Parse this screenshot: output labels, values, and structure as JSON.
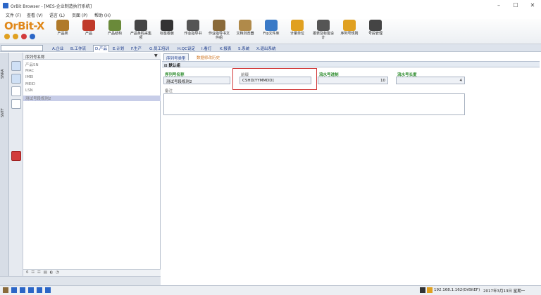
{
  "window": {
    "title": "OrBit Browser - [MES-企业制造执行系统]",
    "minimize": "–",
    "maximize": "☐",
    "close": "✕"
  },
  "menu": [
    "文件 (F)",
    "查看 (V)",
    "语言 (L)",
    "页面 (P)",
    "帮助 (H)"
  ],
  "logo": "OrBit-X",
  "toolbar": [
    {
      "label": "产品类",
      "icon": "product-class-icon",
      "color": "#b07a2a"
    },
    {
      "label": "产品",
      "icon": "product-icon",
      "color": "#c03a2a"
    },
    {
      "label": "产品结构",
      "icon": "product-structure-icon",
      "color": "#6a8a3a"
    },
    {
      "label": "产品条码采集项",
      "icon": "barcode-collect-icon",
      "color": "#444444"
    },
    {
      "label": "标签模板",
      "icon": "label-template-icon",
      "color": "#333333"
    },
    {
      "label": "作业指导书",
      "icon": "work-instruction-icon",
      "color": "#555555"
    },
    {
      "label": "作业指导书文件组",
      "icon": "instruction-group-icon",
      "color": "#8a6a3a"
    },
    {
      "label": "文档浏览器",
      "icon": "doc-browser-icon",
      "color": "#b08a4a"
    },
    {
      "label": "Ftp文件库",
      "icon": "ftp-library-icon",
      "color": "#3a7ac7"
    },
    {
      "label": "计量单位",
      "icon": "unit-icon",
      "color": "#e0a020"
    },
    {
      "label": "报表及标签设计",
      "icon": "report-design-icon",
      "color": "#555555"
    },
    {
      "label": "序列号规则",
      "icon": "serial-rule-icon",
      "color": "#e0a020"
    },
    {
      "label": "号段管理",
      "icon": "segment-manage-icon",
      "color": "#444444"
    }
  ],
  "modules": [
    {
      "label": "A.企业",
      "active": false
    },
    {
      "label": "B.工作流",
      "active": false
    },
    {
      "label": "D.产品",
      "active": true
    },
    {
      "label": "E.计划",
      "active": false
    },
    {
      "label": "F.生产",
      "active": false
    },
    {
      "label": "G.员工培训",
      "active": false
    },
    {
      "label": "H.QC设定",
      "active": false
    },
    {
      "label": "I.看灯",
      "active": false
    },
    {
      "label": "K.报表",
      "active": false
    },
    {
      "label": "S.系统",
      "active": false
    },
    {
      "label": "X.退出系统",
      "active": false
    }
  ],
  "side_tabs": [
    "SNRA",
    "SNTF"
  ],
  "list": {
    "header": "序列号名称",
    "filter_icon": "▼",
    "items": [
      "产品SN",
      "MAC",
      "IMEI",
      "MEID",
      "LSN",
      "测试号段规则2"
    ],
    "selected_index": 5,
    "footer": "6 ☲ ☲ ▤ ◐ ◔"
  },
  "detail": {
    "tabs": [
      {
        "label": "序列号类型",
        "active": true
      },
      {
        "label": "数据修改历史",
        "active": false
      }
    ],
    "group": "⊟ 默认组",
    "fields": {
      "name_label": "序列号名称",
      "name_value": "测试号段规则2",
      "prefix_label": "前缀",
      "prefix_value": "CSHD[YYMMDD]",
      "base_label": "流水号进制",
      "base_value": "10",
      "length_label": "流水号长度",
      "length_value": "4",
      "notes_label": "备注",
      "notes_value": ""
    }
  },
  "status": {
    "ip": "192.168.1.162(OrBitEF)",
    "date": "2017年3月13日 星期一"
  },
  "colors": {
    "accent": "#1a3a8a",
    "green_label": "#2a8a2a",
    "highlight": "#d23b3b",
    "selected_row": "#c7cde8"
  }
}
